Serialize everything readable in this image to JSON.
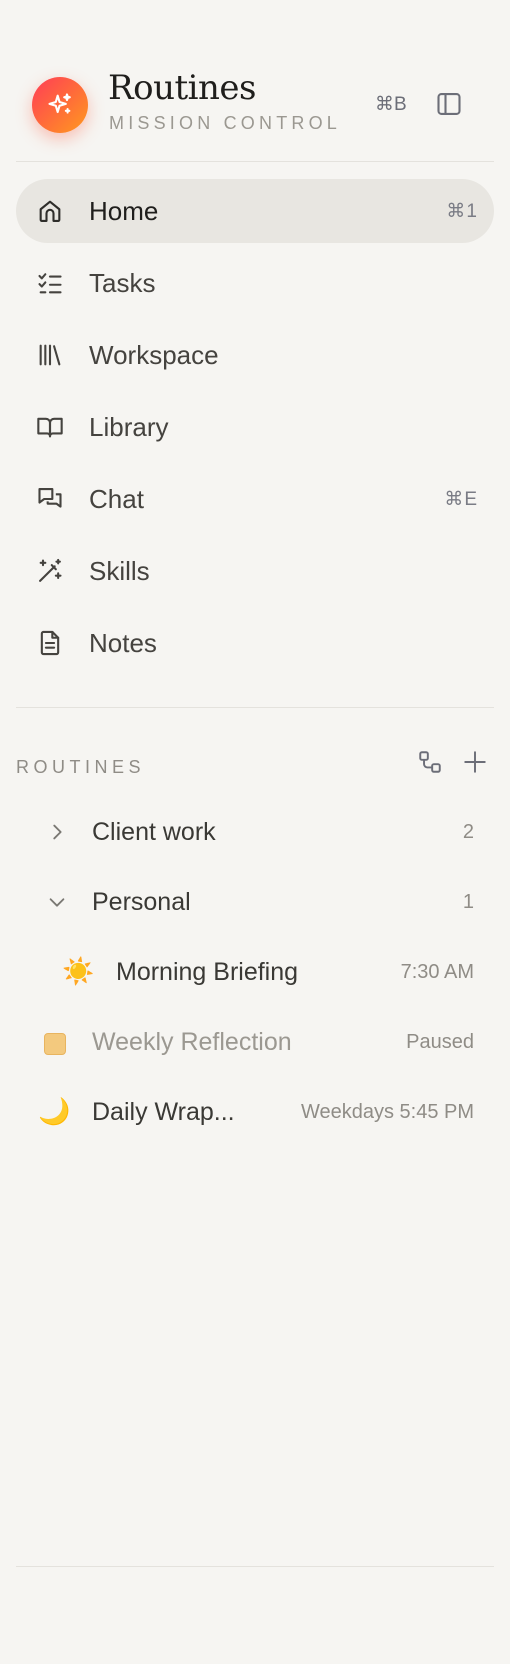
{
  "header": {
    "title": "Routines",
    "subtitle": "MISSION CONTROL",
    "toggle_shortcut": "⌘B"
  },
  "nav": [
    {
      "label": "Home",
      "shortcut": "⌘1",
      "icon": "home-icon",
      "active": true
    },
    {
      "label": "Tasks",
      "shortcut": "",
      "icon": "checklist-icon"
    },
    {
      "label": "Workspace",
      "shortcut": "",
      "icon": "library-books-icon"
    },
    {
      "label": "Library",
      "shortcut": "",
      "icon": "open-book-icon"
    },
    {
      "label": "Chat",
      "shortcut": "⌘E",
      "icon": "chat-bubbles-icon"
    },
    {
      "label": "Skills",
      "shortcut": "",
      "icon": "magic-wand-icon"
    },
    {
      "label": "Notes",
      "shortcut": "",
      "icon": "document-icon"
    }
  ],
  "routines": {
    "section_label": "ROUTINES",
    "groups": [
      {
        "label": "Client work",
        "count": "2",
        "expanded": false
      },
      {
        "label": "Personal",
        "count": "1",
        "expanded": true
      }
    ],
    "items": [
      {
        "emoji": "☀️",
        "label": "Morning Briefing",
        "meta": "7:30 AM"
      },
      {
        "label": "Weekly Reflection",
        "meta": "Paused",
        "paused": true
      },
      {
        "emoji": "🌙",
        "label": "Daily Wrap...",
        "meta": "Weekdays 5:45 PM"
      }
    ]
  },
  "colors": {
    "accent_start": "#ff3d57",
    "accent_end": "#ff9a1f",
    "background": "#f6f5f2",
    "active_bg": "#e8e6e1"
  }
}
